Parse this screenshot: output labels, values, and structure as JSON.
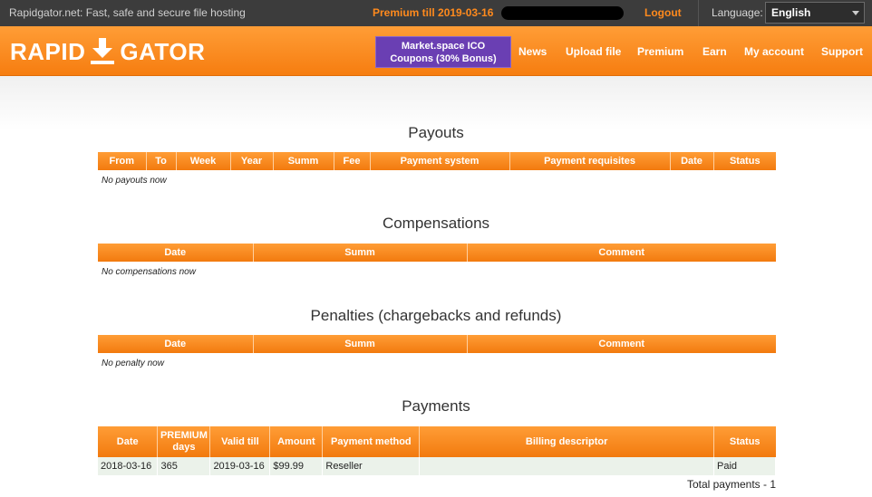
{
  "topbar": {
    "tagline": "Rapidgator.net: Fast, safe and secure file hosting",
    "premium": "Premium till 2019-03-16",
    "logout": "Logout",
    "language_label": "Language:",
    "language_value": "English"
  },
  "header": {
    "logo_left": "RAPID",
    "logo_right": "GATOR",
    "promo_line1": "Market.space ICO",
    "promo_line2": "Coupons (30% Bonus)",
    "nav": [
      "News",
      "Upload file",
      "Premium",
      "Earn",
      "My account",
      "Support"
    ]
  },
  "payouts": {
    "title": "Payouts",
    "columns": [
      "From",
      "To",
      "Week",
      "Year",
      "Summ",
      "Fee",
      "Payment system",
      "Payment requisites",
      "Date",
      "Status"
    ],
    "empty": "No payouts now"
  },
  "compensations": {
    "title": "Compensations",
    "columns": [
      "Date",
      "Summ",
      "Comment"
    ],
    "empty": "No compensations now"
  },
  "penalties": {
    "title": "Penalties (chargebacks and refunds)",
    "columns": [
      "Date",
      "Summ",
      "Comment"
    ],
    "empty": "No penalty now"
  },
  "payments": {
    "title": "Payments",
    "columns": [
      "Date",
      "PREMIUM days",
      "Valid till",
      "Amount",
      "Payment method",
      "Billing descriptor",
      "Status"
    ],
    "rows": [
      [
        "2018-03-16",
        "365",
        "2019-03-16",
        "$99.99",
        "Reseller",
        "",
        "Paid"
      ]
    ],
    "total": "Total payments - 1"
  },
  "colors": {
    "accent": "#f67d10",
    "topbar": "#3c3c3c",
    "promo": "#6a3fb3",
    "row": "#ebf2ea"
  }
}
